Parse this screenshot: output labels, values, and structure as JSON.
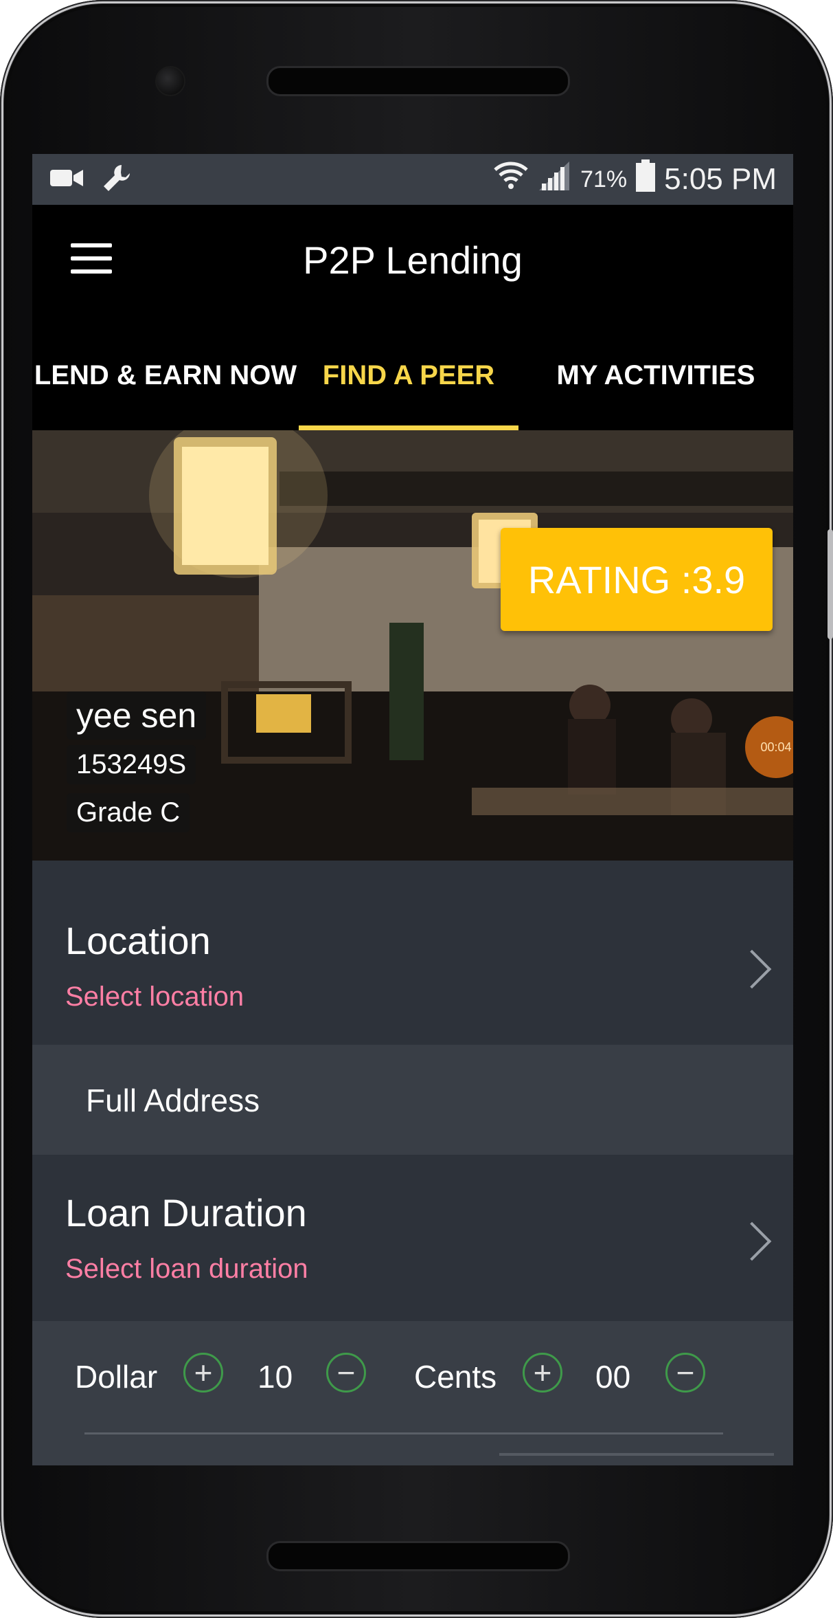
{
  "status_bar": {
    "battery_percent": "71%",
    "time": "5:05 PM",
    "icons": [
      "video-camera-icon",
      "wrench-icon",
      "wifi-icon",
      "cell-signal-icon",
      "battery-icon"
    ]
  },
  "app_bar": {
    "title": "P2P Lending",
    "menu_icon": "hamburger-menu-icon"
  },
  "tabs": [
    {
      "label": "LEND & EARN NOW",
      "active": false
    },
    {
      "label": "FIND A PEER",
      "active": true
    },
    {
      "label": "MY ACTIVITIES",
      "active": false
    }
  ],
  "peer": {
    "name": "yee sen",
    "id": "153249S",
    "grade": "Grade C",
    "rating": "RATING :3.9"
  },
  "recording": {
    "timer": "00:04"
  },
  "location": {
    "title": "Location",
    "subtitle": "Select location"
  },
  "address": {
    "label": "Full Address"
  },
  "loan_duration": {
    "title": "Loan Duration",
    "subtitle": "Select loan duration"
  },
  "amount": {
    "dollar_label": "Dollar",
    "dollar_value": "10",
    "cents_label": "Cents",
    "cents_value": "00",
    "plus_symbol": "+",
    "minus_symbol": "−"
  },
  "colors": {
    "accent": "#f7d64a",
    "rating_bg": "#ffc107",
    "subtitle_pink": "#ff7fa5",
    "stepper_green": "#3f9a4a",
    "panel_dark": "#2d323a",
    "panel_light": "#393e46"
  }
}
